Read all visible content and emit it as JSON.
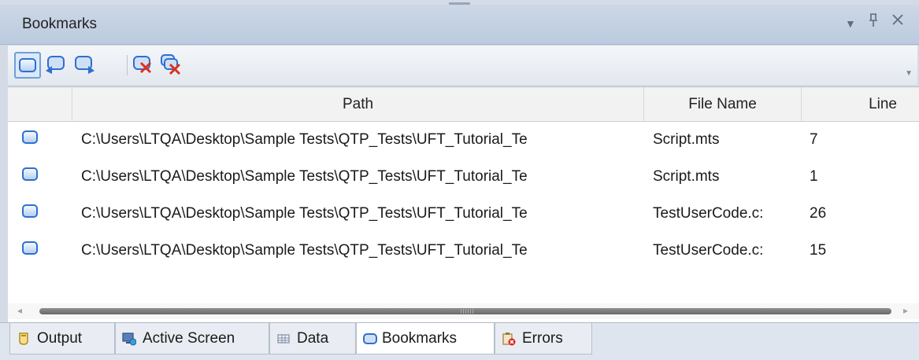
{
  "panel": {
    "title": "Bookmarks"
  },
  "window_controls": {
    "menu_glyph": "▾",
    "pin_glyph": "ᵖ",
    "close_glyph": "✕"
  },
  "toolbar": {
    "buttons": [
      {
        "name": "toggle-bookmark",
        "icon": "bookmark-icon"
      },
      {
        "name": "previous-bookmark",
        "icon": "bookmark-prev-icon"
      },
      {
        "name": "next-bookmark",
        "icon": "bookmark-next-icon"
      },
      {
        "name": "delete-bookmark",
        "icon": "bookmark-delete-icon"
      },
      {
        "name": "delete-all-bookmarks",
        "icon": "bookmark-delete-all-icon"
      }
    ]
  },
  "table": {
    "columns": [
      "",
      "Path",
      "File Name",
      "Line"
    ],
    "rows": [
      {
        "path": "C:\\Users\\LTQA\\Desktop\\Sample Tests\\QTP_Tests\\UFT_Tutorial_Te",
        "file": "Script.mts",
        "line": "7"
      },
      {
        "path": "C:\\Users\\LTQA\\Desktop\\Sample Tests\\QTP_Tests\\UFT_Tutorial_Te",
        "file": "Script.mts",
        "line": "1"
      },
      {
        "path": "C:\\Users\\LTQA\\Desktop\\Sample Tests\\QTP_Tests\\UFT_Tutorial_Te",
        "file": "TestUserCode.c:",
        "line": "26"
      },
      {
        "path": "C:\\Users\\LTQA\\Desktop\\Sample Tests\\QTP_Tests\\UFT_Tutorial_Te",
        "file": "TestUserCode.c:",
        "line": "15"
      }
    ]
  },
  "tabs": [
    {
      "label": "Output",
      "icon": "output-icon",
      "active": false
    },
    {
      "label": "Active Screen",
      "icon": "active-screen-icon",
      "active": false
    },
    {
      "label": "Data",
      "icon": "data-table-icon",
      "active": false
    },
    {
      "label": "Bookmarks",
      "icon": "bookmark-icon",
      "active": true
    },
    {
      "label": "Errors",
      "icon": "errors-icon",
      "active": false
    }
  ],
  "colors": {
    "accent": "#2f6fcf",
    "titlebar": "#c4d1e3"
  }
}
